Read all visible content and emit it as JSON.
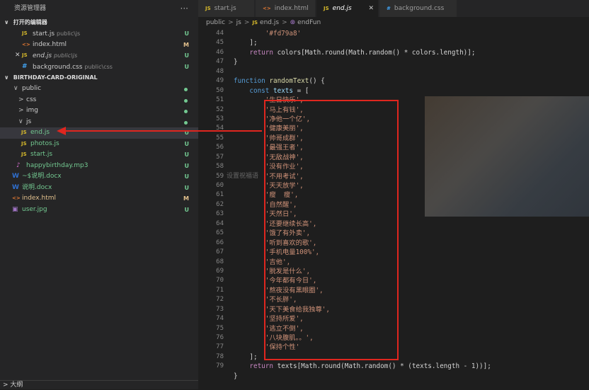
{
  "sidebar": {
    "title": "资源管理器",
    "more": "···",
    "open_editors_label": "打开的编辑器",
    "open_editors": [
      {
        "name": "start.js",
        "path": "public\\js",
        "badge": "U",
        "icon": "JS"
      },
      {
        "name": "index.html",
        "path": "",
        "badge": "M",
        "icon": "<>"
      },
      {
        "name": "end.js",
        "path": "public\\js",
        "badge": "U",
        "icon": "JS"
      },
      {
        "name": "background.css",
        "path": "public\\css",
        "badge": "U",
        "icon": "#"
      }
    ],
    "project_label": "BIRTHDAY-CARD-ORIGINAL",
    "tree": [
      {
        "name": "public",
        "badge": "",
        "kind": "folder-open"
      },
      {
        "name": "css",
        "badge": "",
        "kind": "folder"
      },
      {
        "name": "img",
        "badge": "",
        "kind": "folder"
      },
      {
        "name": "js",
        "badge": "",
        "kind": "folder-open"
      },
      {
        "name": "end.js",
        "badge": "U",
        "kind": "js"
      },
      {
        "name": "photos.js",
        "badge": "U",
        "kind": "js"
      },
      {
        "name": "start.js",
        "badge": "U",
        "kind": "js"
      },
      {
        "name": "happybirthday.mp3",
        "badge": "U",
        "kind": "mp3"
      },
      {
        "name": "~$说明.docx",
        "badge": "U",
        "kind": "doc"
      },
      {
        "name": "说明.docx",
        "badge": "U",
        "kind": "doc"
      },
      {
        "name": "index.html",
        "badge": "M",
        "kind": "html"
      },
      {
        "name": "user.jpg",
        "badge": "U",
        "kind": "img"
      }
    ],
    "outline_label": "大纲"
  },
  "tabs": [
    {
      "label": "start.js",
      "icon": "JS"
    },
    {
      "label": "index.html",
      "icon": "<>"
    },
    {
      "label": "end.js",
      "icon": "JS"
    },
    {
      "label": "background.css",
      "icon": "#"
    }
  ],
  "breadcrumb": [
    "public",
    "js",
    "end.js",
    "endFun"
  ],
  "ghost_text": "设置祝福语",
  "code": {
    "line_numbers": [
      44,
      45,
      46,
      47,
      48,
      49,
      50,
      51,
      52,
      53,
      54,
      55,
      56,
      57,
      58,
      59,
      60,
      61,
      62,
      63,
      64,
      65,
      66,
      67,
      68,
      69,
      70,
      71,
      72,
      73,
      74,
      75,
      76,
      77,
      78,
      79
    ],
    "first_line": "'#fd79a8'",
    "array_close": "];",
    "return_colors": "colors[Math.round(Math.random() * colors.length)];",
    "func_close": "}",
    "func_name": "randomText",
    "const_name": "texts",
    "texts": [
      "'生日快乐',",
      "'马上有钱',",
      "'净他一个亿',",
      "'健康美丽',",
      "'帅哥成群',",
      "'最强王者',",
      "'无敌战神',",
      "'没有作业',",
      "'不用考试',",
      "'天天放学',",
      "'瘦  瘦',",
      "'自然醒',",
      "'天然日',",
      "'还要继续长高',",
      "'饿了有外卖',",
      "'听到喜欢的歌',",
      "'手机电量100%',",
      "'吉他',",
      "'脱发是什么',",
      "'今年都有今日',",
      "'熬夜没有黑眼圈',",
      "'不长胖',",
      "'天下美食给我独尊',",
      "'坚持所爱',",
      "'逃立不倒',",
      "'八块腹肌。。',",
      "'保持个性'"
    ],
    "return_texts": "texts[Math.round(Math.random() * (texts.length - 1))];",
    "final_close": "}"
  },
  "colors": {
    "annotation": "#e0261f",
    "untracked": "#73c991",
    "modified": "#e2c08d"
  }
}
